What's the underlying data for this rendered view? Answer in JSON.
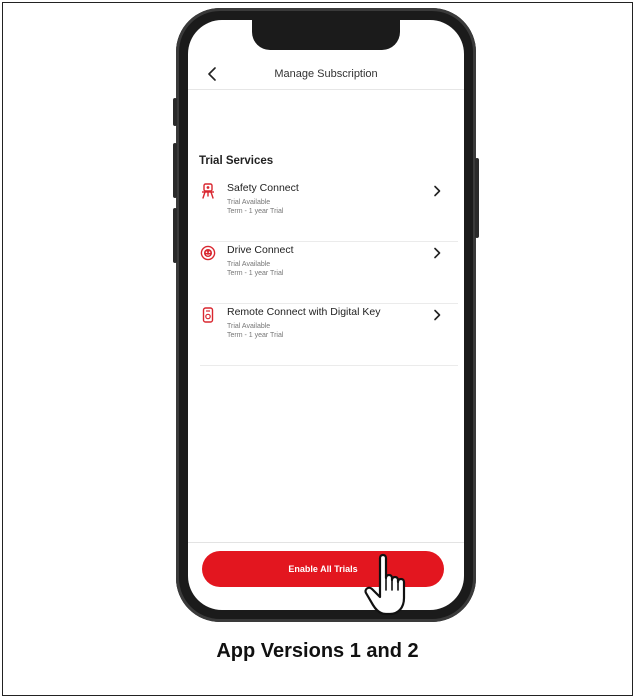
{
  "header": {
    "title": "Manage Subscription",
    "back_icon": "chevron-left-icon"
  },
  "section": {
    "title": "Trial Services"
  },
  "services": [
    {
      "name": "Safety Connect",
      "status": "Trial Available",
      "term": "Term - 1 year Trial",
      "icon": "safety-connect-icon"
    },
    {
      "name": "Drive Connect",
      "status": "Trial Available",
      "term": "Term - 1 year Trial",
      "icon": "drive-connect-icon"
    },
    {
      "name": "Remote Connect with Digital Key",
      "status": "Trial Available",
      "term": "Term - 1 year Trial",
      "icon": "remote-connect-icon"
    }
  ],
  "footer": {
    "enable_label": "Enable All Trials"
  },
  "caption": "App Versions 1 and 2",
  "colors": {
    "accent": "#e3161f",
    "icon": "#d9262f"
  }
}
